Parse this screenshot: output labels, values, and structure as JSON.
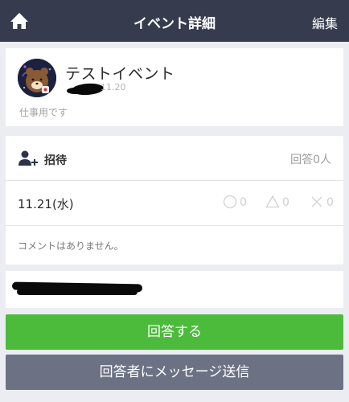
{
  "header": {
    "title": "イベント詳細",
    "edit_label": "編集"
  },
  "event": {
    "title": "テストイベント",
    "date": "11.20",
    "description": "仕事用です"
  },
  "invite": {
    "label": "招待",
    "respond_count": "回答0人"
  },
  "schedule": {
    "date_label": "11.21(水)",
    "votes": {
      "circle": "0",
      "triangle": "0",
      "cross": "0"
    }
  },
  "comments": {
    "empty_text": "コメントはありません。"
  },
  "actions": {
    "answer_label": "回答する",
    "message_label": "回答者にメッセージ送信"
  },
  "colors": {
    "header_bg": "#363c4e",
    "answer_button": "#4cbb3c",
    "message_button": "#6c7284",
    "page_bg": "#ebedf2"
  }
}
